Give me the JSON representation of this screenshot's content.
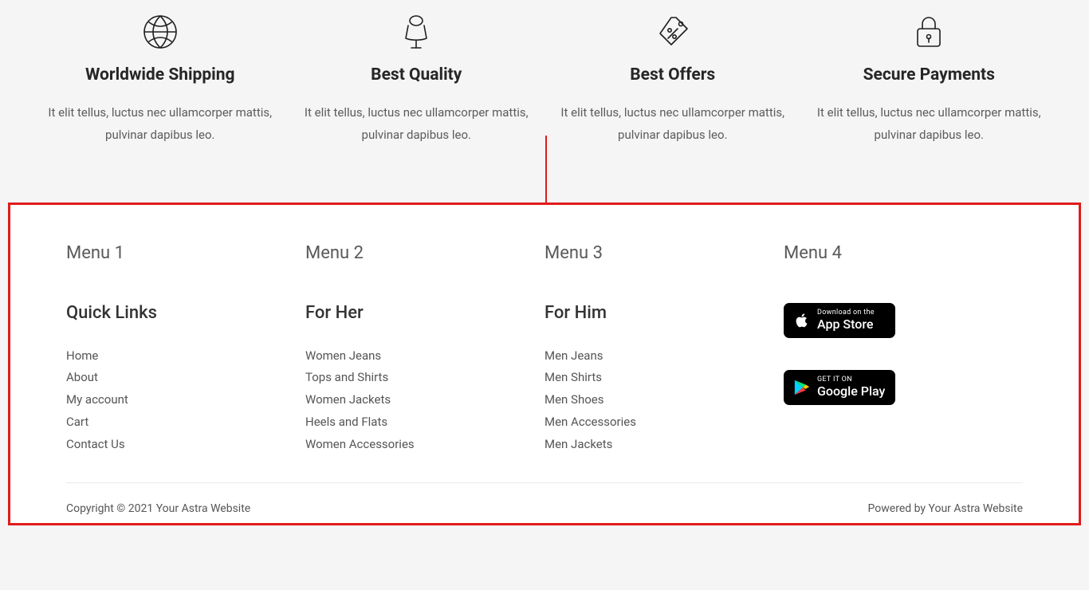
{
  "features": [
    {
      "title": "Worldwide Shipping",
      "desc": "It elit tellus, luctus nec ullamcorper mattis, pulvinar dapibus leo."
    },
    {
      "title": "Best Quality",
      "desc": "It elit tellus, luctus nec ullamcorper mattis, pulvinar dapibus leo."
    },
    {
      "title": "Best Offers",
      "desc": "It elit tellus, luctus nec ullamcorper mattis, pulvinar dapibus leo."
    },
    {
      "title": "Secure Payments",
      "desc": "It elit tellus, luctus nec ullamcorper mattis, pulvinar dapibus leo."
    }
  ],
  "footer": {
    "columns": [
      {
        "menu": "Menu 1",
        "heading": "Quick Links",
        "links": [
          "Home",
          "About",
          "My account",
          "Cart",
          "Contact Us"
        ]
      },
      {
        "menu": "Menu 2",
        "heading": "For Her",
        "links": [
          "Women Jeans",
          "Tops and Shirts",
          "Women Jackets",
          "Heels and Flats",
          "Women Accessories"
        ]
      },
      {
        "menu": "Menu 3",
        "heading": "For Him",
        "links": [
          "Men Jeans",
          "Men Shirts",
          "Men Shoes",
          "Men Accessories",
          "Men Jackets"
        ]
      },
      {
        "menu": "Menu 4",
        "appstore": {
          "top": "Download on the",
          "bottom": "App Store"
        },
        "playstore": {
          "top": "GET IT ON",
          "bottom": "Google Play"
        }
      }
    ],
    "copyright": "Copyright © 2021 Your Astra Website",
    "powered": "Powered by Your Astra Website"
  }
}
